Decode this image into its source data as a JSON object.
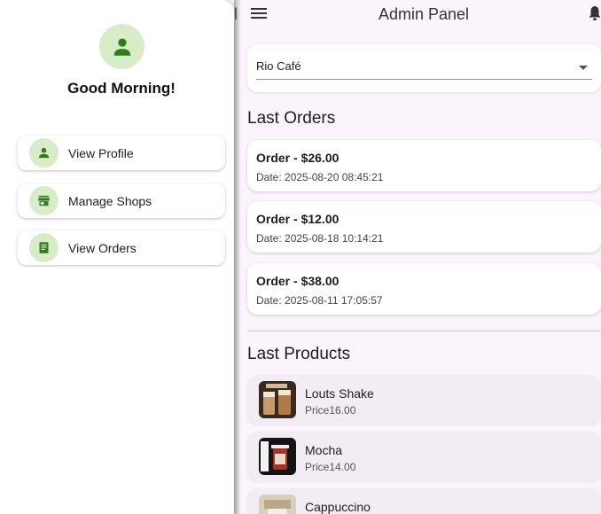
{
  "app_bar": {
    "title": "Admin Panel",
    "peek_char": "l"
  },
  "shop_dropdown": {
    "selected": "Rio Café"
  },
  "orders": {
    "title": "Last Orders",
    "items": [
      {
        "title": "Order - $26.00",
        "date": "Date: 2025-08-20 08:45:21"
      },
      {
        "title": "Order - $12.00",
        "date": "Date: 2025-08-18 10:14:21"
      },
      {
        "title": "Order - $38.00",
        "date": "Date: 2025-08-11 17:05:57"
      }
    ]
  },
  "products": {
    "title": "Last Products",
    "items": [
      {
        "name": "Louts Shake",
        "price": "Price16.00"
      },
      {
        "name": "Mocha",
        "price": "Price14.00"
      },
      {
        "name": "Cappuccino",
        "price": ""
      }
    ]
  },
  "drawer": {
    "greeting": "Good Morning!",
    "items": [
      {
        "label": "View Profile",
        "icon": "person-icon"
      },
      {
        "label": "Manage Shops",
        "icon": "store-icon"
      },
      {
        "label": "View Orders",
        "icon": "receipt-icon"
      }
    ]
  },
  "colors": {
    "accent": "#2e7d1c",
    "accent_bg": "#d8ecc8",
    "background": "#fcf4fc"
  }
}
